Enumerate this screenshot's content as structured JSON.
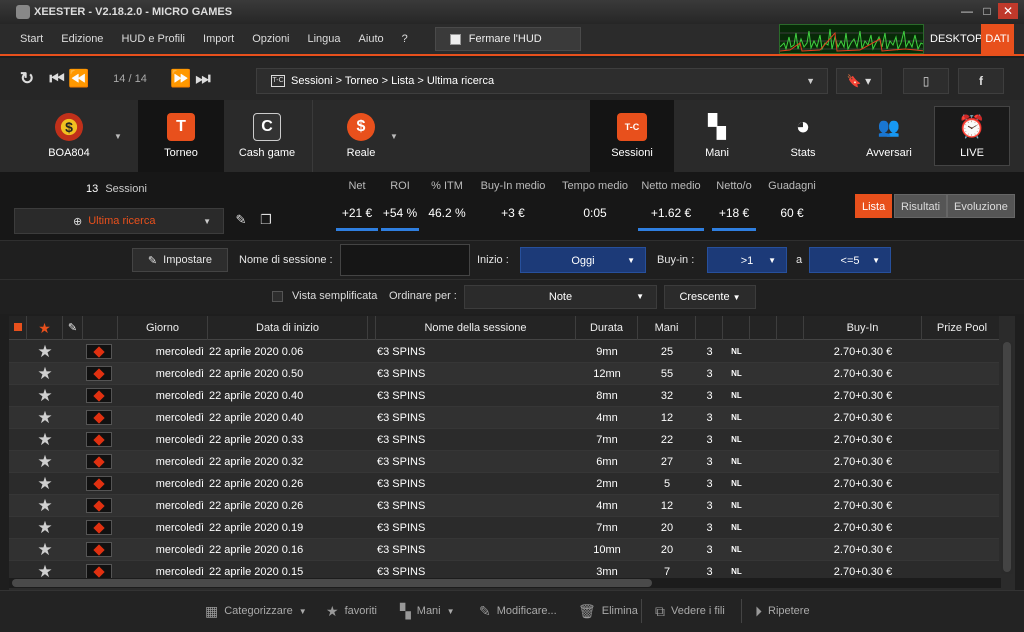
{
  "window": {
    "title": "XEESTER - V2.18.2.0 - MICRO GAMES",
    "minimize": "—",
    "maximize": "□",
    "close": "✕"
  },
  "menu": {
    "items": [
      "Start",
      "Edizione",
      "HUD e Profili",
      "Import",
      "Opzioni",
      "Lingua",
      "Aiuto",
      "?"
    ],
    "hud_button": "Fermare l'HUD",
    "desktop": "DESKTOP",
    "dati": "DATI"
  },
  "nav": {
    "page": "14 / 14",
    "breadcrumb": "Sessioni > Torneo > Lista > Ultima ricerca",
    "tc_label": "T-C"
  },
  "tabs": {
    "boa": "BOA804",
    "torneo": "Torneo",
    "torneo_icon": "T",
    "cash": "Cash game",
    "cash_icon": "C",
    "reale": "Reale",
    "sessioni": "Sessioni",
    "sessioni_icon": "T-C",
    "mani": "Mani",
    "stats": "Stats",
    "avversari": "Avversari",
    "live": "LIVE"
  },
  "summary": {
    "count": "13",
    "count_label": "Sessioni",
    "search": "Ultima ricerca",
    "stats": [
      {
        "label": "Net",
        "value": "+21 €"
      },
      {
        "label": "ROI",
        "value": "+54 %"
      },
      {
        "label": "% ITM",
        "value": "46.2 %"
      },
      {
        "label": "Buy-In medio",
        "value": "+3 €"
      },
      {
        "label": "Tempo medio",
        "value": "0:05"
      },
      {
        "label": "Netto medio",
        "value": "+1.62 €"
      },
      {
        "label": "Netto/o",
        "value": "+18 €"
      },
      {
        "label": "Guadagni",
        "value": "60 €"
      }
    ],
    "views": [
      "Lista",
      "Risultati",
      "Evoluzione"
    ]
  },
  "filters": {
    "impostare": "Impostare",
    "nome_label": "Nome di sessione :",
    "nome_value": "",
    "inizio_label": "Inizio :",
    "inizio_value": "Oggi",
    "buyin_label": "Buy-in :",
    "buyin_from": ">1",
    "a_label": "a",
    "buyin_to": "<=5"
  },
  "sort": {
    "simplified_label": "Vista semplificata",
    "order_label": "Ordinare per :",
    "order_value": "Note",
    "direction": "Crescente"
  },
  "table": {
    "headers": {
      "giorno": "Giorno",
      "data": "Data di inizio",
      "nome": "Nome della sessione",
      "durata": "Durata",
      "mani": "Mani",
      "buyin": "Buy-In",
      "prize": "Prize Pool"
    },
    "rows": [
      {
        "day": "mercoledì",
        "date": "22 aprile 2020 0.06",
        "name": "€3 SPINS",
        "dur": "9mn",
        "hands": "25",
        "players": "3",
        "type": "NL",
        "buyin": "2.70+0.30 €"
      },
      {
        "day": "mercoledì",
        "date": "22 aprile 2020 0.50",
        "name": "€3 SPINS",
        "dur": "12mn",
        "hands": "55",
        "players": "3",
        "type": "NL",
        "buyin": "2.70+0.30 €"
      },
      {
        "day": "mercoledì",
        "date": "22 aprile 2020 0.40",
        "name": "€3 SPINS",
        "dur": "8mn",
        "hands": "32",
        "players": "3",
        "type": "NL",
        "buyin": "2.70+0.30 €"
      },
      {
        "day": "mercoledì",
        "date": "22 aprile 2020 0.40",
        "name": "€3 SPINS",
        "dur": "4mn",
        "hands": "12",
        "players": "3",
        "type": "NL",
        "buyin": "2.70+0.30 €"
      },
      {
        "day": "mercoledì",
        "date": "22 aprile 2020 0.33",
        "name": "€3 SPINS",
        "dur": "7mn",
        "hands": "22",
        "players": "3",
        "type": "NL",
        "buyin": "2.70+0.30 €"
      },
      {
        "day": "mercoledì",
        "date": "22 aprile 2020 0.32",
        "name": "€3 SPINS",
        "dur": "6mn",
        "hands": "27",
        "players": "3",
        "type": "NL",
        "buyin": "2.70+0.30 €"
      },
      {
        "day": "mercoledì",
        "date": "22 aprile 2020 0.26",
        "name": "€3 SPINS",
        "dur": "2mn",
        "hands": "5",
        "players": "3",
        "type": "NL",
        "buyin": "2.70+0.30 €"
      },
      {
        "day": "mercoledì",
        "date": "22 aprile 2020 0.26",
        "name": "€3 SPINS",
        "dur": "4mn",
        "hands": "12",
        "players": "3",
        "type": "NL",
        "buyin": "2.70+0.30 €"
      },
      {
        "day": "mercoledì",
        "date": "22 aprile 2020 0.19",
        "name": "€3 SPINS",
        "dur": "7mn",
        "hands": "20",
        "players": "3",
        "type": "NL",
        "buyin": "2.70+0.30 €"
      },
      {
        "day": "mercoledì",
        "date": "22 aprile 2020 0.16",
        "name": "€3 SPINS",
        "dur": "10mn",
        "hands": "20",
        "players": "3",
        "type": "NL",
        "buyin": "2.70+0.30 €"
      },
      {
        "day": "mercoledì",
        "date": "22 aprile 2020 0.15",
        "name": "€3 SPINS",
        "dur": "3mn",
        "hands": "7",
        "players": "3",
        "type": "NL",
        "buyin": "2.70+0.30 €"
      }
    ]
  },
  "bottom": {
    "categorizzare": "Categorizzare",
    "favoriti": "favoriti",
    "mani": "Mani",
    "modificare": "Modificare...",
    "elimina": "Elimina",
    "vedere": "Vedere i fili",
    "ripetere": "Ripetere"
  },
  "colors": {
    "accent": "#e8501c",
    "blue": "#1c3a78"
  }
}
